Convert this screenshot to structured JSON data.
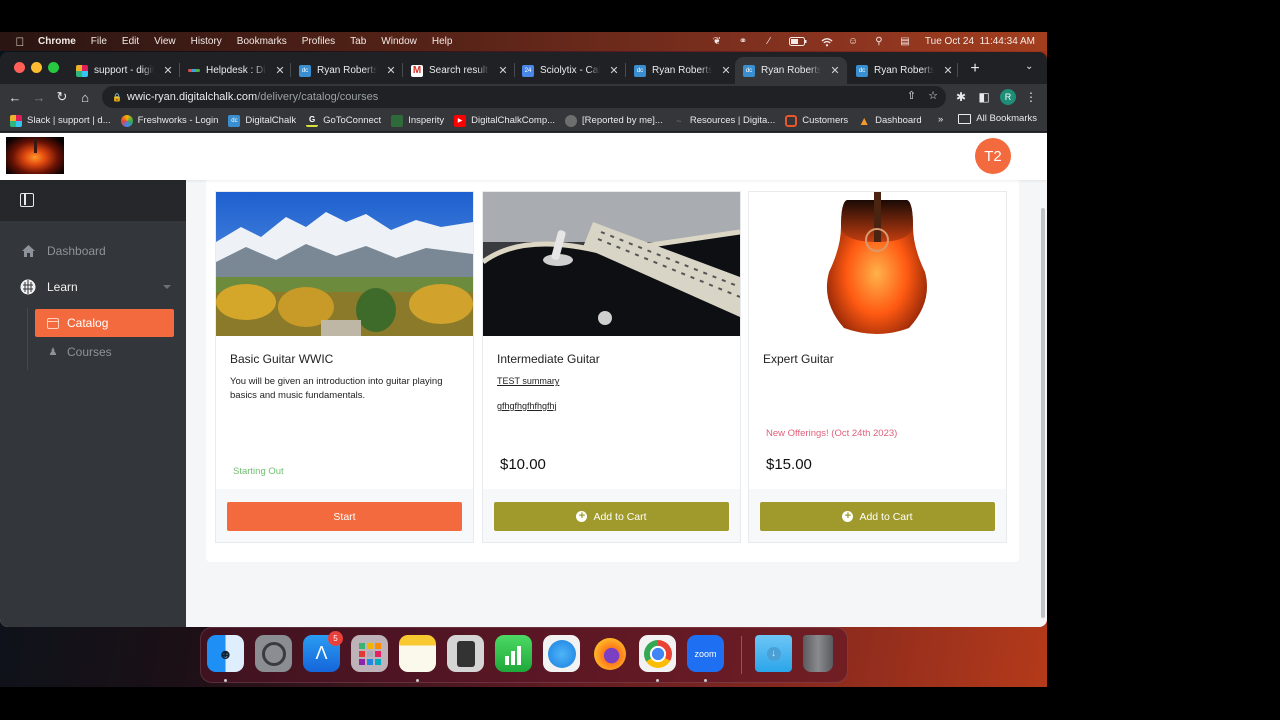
{
  "menubar": {
    "app_name": "Chrome",
    "items": [
      "File",
      "Edit",
      "View",
      "History",
      "Bookmarks",
      "Profiles",
      "Tab",
      "Window",
      "Help"
    ],
    "status_icons": [
      "feather-icon",
      "headphones-icon",
      "pen-slash-icon",
      "battery-icon",
      "wifi-icon",
      "user-circle-icon",
      "spotlight-search-icon",
      "control-center-icon"
    ],
    "clock": "Tue Oct 24  11:44:34 AM"
  },
  "browser": {
    "tabs": [
      {
        "title": "support - digita",
        "icon": "slack-icon",
        "active": false
      },
      {
        "title": "Helpdesk : Digi",
        "icon": "freshworks-icon",
        "active": false
      },
      {
        "title": "Ryan Roberts E",
        "icon": "digitalchalk-icon",
        "active": false
      },
      {
        "title": "Search results",
        "icon": "gmail-icon",
        "active": false
      },
      {
        "title": "Sciolytix - Cale",
        "icon": "calendar-icon",
        "active": false
      },
      {
        "title": "Ryan Roberts C",
        "icon": "digitalchalk-icon",
        "active": false
      },
      {
        "title": "Ryan Roberts C",
        "icon": "digitalchalk-icon",
        "active": true
      },
      {
        "title": "Ryan Roberts D",
        "icon": "digitalchalk-icon",
        "active": false
      }
    ],
    "new_tab_label": "+",
    "url_host": "wwic-ryan.digitalchalk.com",
    "url_path": "/delivery/catalog/courses",
    "profile_initial": "R",
    "bookmarks": [
      {
        "label": "Slack | support | d...",
        "icon": "slack-icon"
      },
      {
        "label": "Freshworks - Login",
        "icon": "freshworks-icon"
      },
      {
        "label": "DigitalChalk",
        "icon": "digitalchalk-icon"
      },
      {
        "label": "GoToConnect",
        "icon": "gotoconnect-icon"
      },
      {
        "label": "Insperity",
        "icon": "insperity-icon"
      },
      {
        "label": "DigitalChalkComp...",
        "icon": "youtube-icon"
      },
      {
        "label": "[Reported by me]...",
        "icon": "globe-icon"
      },
      {
        "label": "Resources | Digita...",
        "icon": "resources-icon"
      },
      {
        "label": "Customers",
        "icon": "chat-icon"
      },
      {
        "label": "Dashboard",
        "icon": "warning-icon"
      }
    ],
    "bookmarks_overflow": "»",
    "all_bookmarks": "All Bookmarks"
  },
  "app": {
    "avatar_initials": "T2",
    "sidebar": {
      "items": [
        {
          "label": "Dashboard",
          "icon": "home-icon"
        },
        {
          "label": "Learn",
          "icon": "brain-icon"
        }
      ],
      "subitems": [
        {
          "label": "Catalog",
          "icon": "catalog-icon",
          "active": true
        },
        {
          "label": "Courses",
          "icon": "courses-icon",
          "active": false
        }
      ]
    },
    "courses": [
      {
        "title": "Basic Guitar WWIC",
        "description": "You will be given an introduction into guitar playing basics and music fundamentals.",
        "tag": "Starting Out",
        "button": "Start",
        "image": "mountain-landscape"
      },
      {
        "title": "Intermediate Guitar",
        "summary": "TEST summary",
        "summary_detail": "gfhgfhgfhfhgfhj",
        "price": "$10.00",
        "button": "Add to Cart",
        "image": "electric-guitar-closeup"
      },
      {
        "title": "Expert Guitar",
        "tag": "New Offerings! (Oct 24th 2023)",
        "price": "$15.00",
        "button": "Add to Cart",
        "image": "flaming-acoustic-guitar"
      }
    ],
    "colors": {
      "accent": "#f26a3d",
      "cart_button": "#a09a2c",
      "tag_green": "#72bf72",
      "tag_pink": "#e0607a",
      "sidebar_bg": "#33363a"
    }
  },
  "dock": {
    "apps": [
      "Finder",
      "System Settings",
      "App Store",
      "Launchpad",
      "Notes",
      "Calculator",
      "Numbers",
      "Safari",
      "Firefox",
      "Chrome",
      "zoom",
      "Downloads",
      "Trash"
    ],
    "app_store_badge": "5",
    "zoom_label": "zoom"
  }
}
